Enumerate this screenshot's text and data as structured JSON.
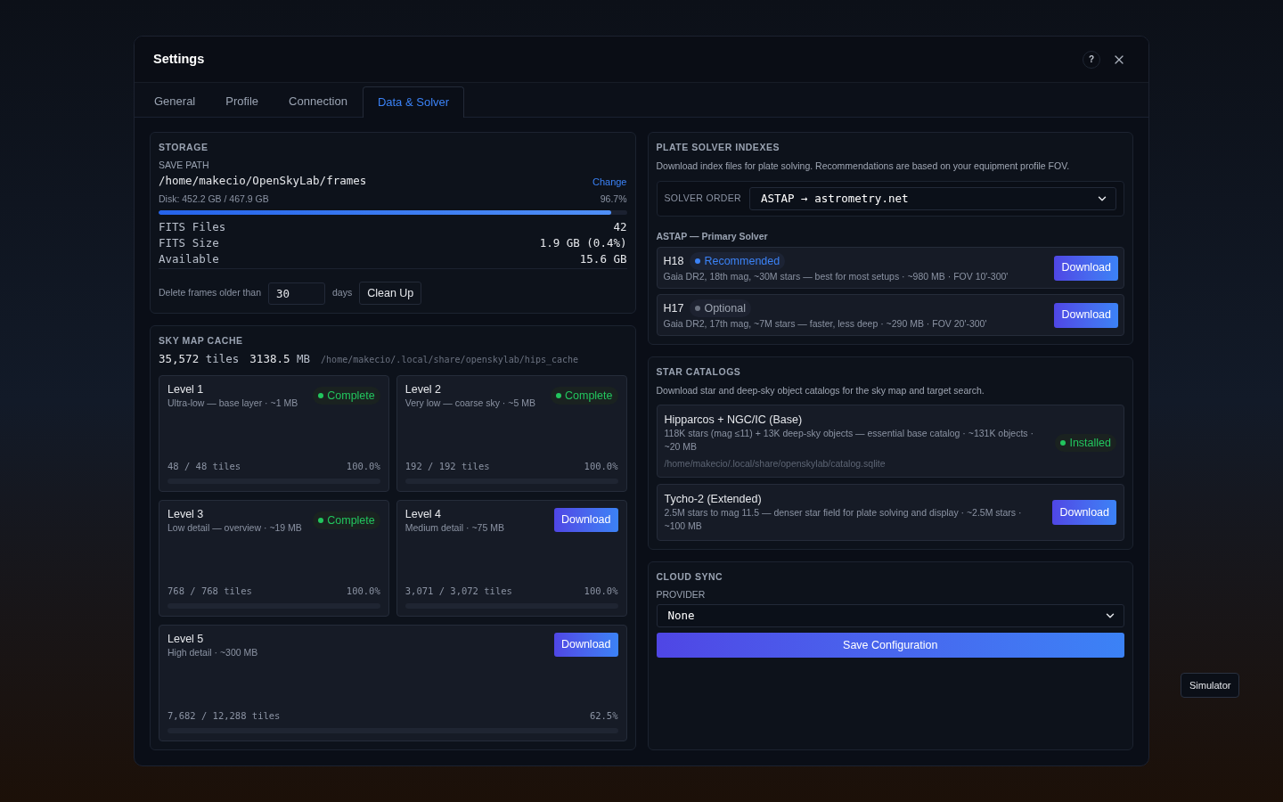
{
  "backdrop": {
    "tooltip": "Simulator"
  },
  "dialog": {
    "title": "Settings",
    "help_button": "?",
    "tabs": [
      {
        "label": "General",
        "selected": false
      },
      {
        "label": "Profile",
        "selected": false
      },
      {
        "label": "Connection",
        "selected": false
      },
      {
        "label": "Data & Solver",
        "selected": true
      }
    ]
  },
  "storage": {
    "heading": "STORAGE",
    "save_path_label": "SAVE PATH",
    "save_path": "/home/makecio/OpenSkyLab/frames",
    "change_link": "Change",
    "disk": {
      "label": "Disk: 452.2 GB / 467.9 GB",
      "percent": "96.7%",
      "level": 0.967
    },
    "stats": [
      {
        "label": "FITS Files",
        "value": "42"
      },
      {
        "label": "FITS Size",
        "value": "1.9 GB (0.4%)"
      },
      {
        "label": "Available",
        "value": "15.6 GB"
      }
    ],
    "cleanup": {
      "label": "Delete frames older than",
      "value": "30",
      "unit": "days",
      "button": "Clean Up"
    }
  },
  "sky_map_cache": {
    "heading": "SKY MAP CACHE",
    "tile_count": "35,572",
    "tile_unit": "tiles",
    "size": "3138.5",
    "size_unit": "MB",
    "path": "/home/makecio/.local/share/openskylab/hips_cache",
    "levels": [
      {
        "name": "Level 1",
        "description": "Ultra-low — base layer · ~1 MB",
        "kind": "complete",
        "status": "Complete",
        "tiles": "48 / 48 tiles",
        "percent": "100.0%"
      },
      {
        "name": "Level 2",
        "description": "Very low — coarse sky · ~5 MB",
        "kind": "complete",
        "status": "Complete",
        "tiles": "192 / 192 tiles",
        "percent": "100.0%"
      },
      {
        "name": "Level 3",
        "description": "Low detail — overview · ~19 MB",
        "kind": "complete",
        "status": "Complete",
        "tiles": "768 / 768 tiles",
        "percent": "100.0%"
      },
      {
        "name": "Level 4",
        "description": "Medium detail · ~75 MB",
        "kind": "download",
        "button": "Download",
        "tiles": "3,071 / 3,072 tiles",
        "percent": "100.0%"
      },
      {
        "name": "Level 5",
        "description": "High detail · ~300 MB",
        "kind": "download",
        "button": "Download",
        "tiles": "7,682 / 12,288 tiles",
        "percent": "62.5%"
      }
    ]
  },
  "plate_solver": {
    "heading": "PLATE SOLVER INDEXES",
    "description": "Download index files for plate solving. Recommendations are based on your equipment profile FOV.",
    "solver_order": {
      "label": "SOLVER ORDER",
      "value": "ASTAP → astrometry.net"
    },
    "astap": {
      "heading": "ASTAP — Primary Solver",
      "indexes": [
        {
          "name": "H18",
          "badge": {
            "kind": "recommended",
            "label": "Recommended"
          },
          "description": "Gaia DR2, 18th mag, ~30M stars — best for most setups · ~980 MB · FOV 10'-300'",
          "button": "Download"
        },
        {
          "name": "H17",
          "badge": {
            "kind": "optional",
            "label": "Optional"
          },
          "description": "Gaia DR2, 17th mag, ~7M stars — faster, less deep · ~290 MB · FOV 20'-300'",
          "button": "Download"
        }
      ]
    }
  },
  "star_catalogs": {
    "heading": "STAR CATALOGS",
    "description": "Download star and deep-sky object catalogs for the sky map and target search.",
    "catalogs": [
      {
        "name": "Hipparcos + NGC/IC (Base)",
        "description": "118K stars (mag ≤11) + 13K deep-sky objects — essential base catalog · ~131K objects · ~20 MB",
        "path": "/home/makecio/.local/share/openskylab/catalog.sqlite",
        "kind": "installed",
        "status": "Installed"
      },
      {
        "name": "Tycho-2 (Extended)",
        "description": "2.5M stars to mag 11.5 — denser star field for plate solving and display · ~2.5M stars · ~100 MB",
        "kind": "download",
        "button": "Download"
      }
    ]
  },
  "cloud_sync": {
    "heading": "CLOUD SYNC",
    "provider_label": "PROVIDER",
    "provider": "None",
    "save_button": "Save Configuration"
  }
}
